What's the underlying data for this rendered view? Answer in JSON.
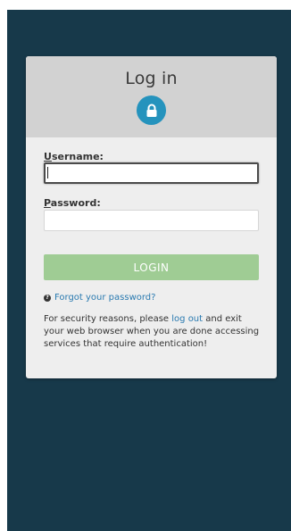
{
  "header": {
    "title": "Log in"
  },
  "form": {
    "username_accel": "U",
    "username_rest": "sername:",
    "username_value": "",
    "password_accel": "P",
    "password_rest": "assword:",
    "password_value": "",
    "login_label": "LOGIN"
  },
  "links": {
    "forgot_password": "Forgot your password?"
  },
  "notice": {
    "before": "For security reasons, please ",
    "link": "log out",
    "after": " and exit your web browser when you are done accessing services that require authentication!"
  },
  "colors": {
    "backdrop": "#17394a",
    "accent": "#2593bd",
    "login_button": "#9fcc94",
    "link": "#2a7ab0"
  },
  "icons": {
    "header": "lock-icon",
    "forgot": "question-circle-icon"
  }
}
